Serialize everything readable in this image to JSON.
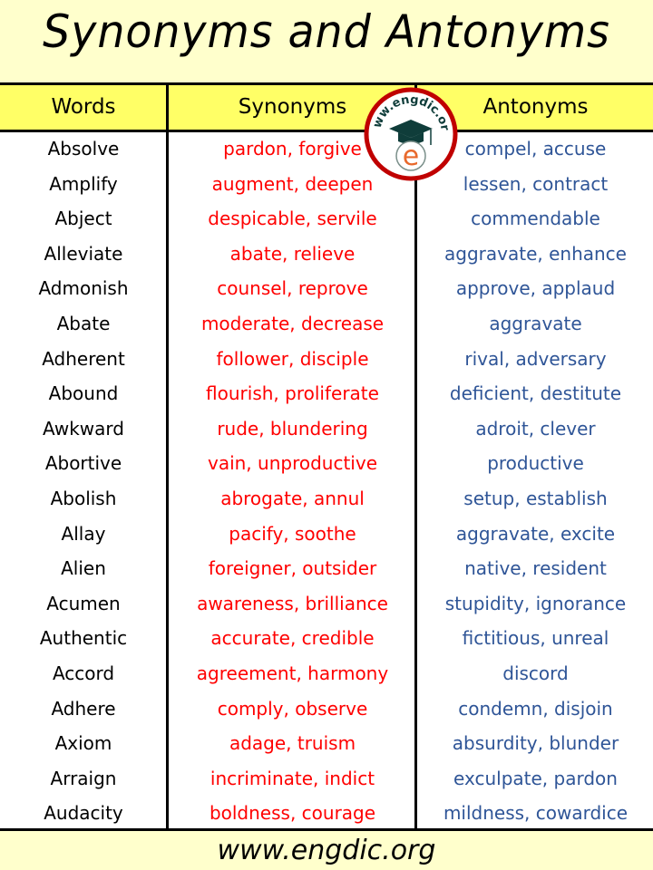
{
  "title": "Synonyms and Antonyms",
  "header": {
    "words": "Words",
    "synonyms": "Synonyms",
    "antonyms": "Antonyms"
  },
  "logo": {
    "text": "www.engdic.org",
    "letter": "e",
    "ring_color": "#c00000",
    "cap_color": "#0f3d3a",
    "letter_color": "#e8692c"
  },
  "colors": {
    "title_bg": "#ffffcc",
    "header_bg": "#ffff66",
    "synonym_text": "#ff0000",
    "antonym_text": "#2f5597"
  },
  "rows": [
    {
      "word": "Absolve",
      "synonyms": "pardon, forgive",
      "antonyms": "compel, accuse"
    },
    {
      "word": "Amplify",
      "synonyms": "augment, deepen",
      "antonyms": "lessen, contract"
    },
    {
      "word": "Abject",
      "synonyms": "despicable, servile",
      "antonyms": "commendable"
    },
    {
      "word": "Alleviate",
      "synonyms": "abate, relieve",
      "antonyms": "aggravate, enhance"
    },
    {
      "word": "Admonish",
      "synonyms": "counsel, reprove",
      "antonyms": "approve, applaud"
    },
    {
      "word": "Abate",
      "synonyms": "moderate, decrease",
      "antonyms": "aggravate"
    },
    {
      "word": "Adherent",
      "synonyms": "follower, disciple",
      "antonyms": "rival, adversary"
    },
    {
      "word": "Abound",
      "synonyms": "flourish, proliferate",
      "antonyms": "deficient, destitute"
    },
    {
      "word": "Awkward",
      "synonyms": "rude, blundering",
      "antonyms": "adroit, clever"
    },
    {
      "word": "Abortive",
      "synonyms": "vain, unproductive",
      "antonyms": "productive"
    },
    {
      "word": "Abolish",
      "synonyms": "abrogate, annul",
      "antonyms": "setup, establish"
    },
    {
      "word": "Allay",
      "synonyms": "pacify, soothe",
      "antonyms": "aggravate, excite"
    },
    {
      "word": "Alien",
      "synonyms": "foreigner, outsider",
      "antonyms": "native, resident"
    },
    {
      "word": "Acumen",
      "synonyms": "awareness, brilliance",
      "antonyms": "stupidity, ignorance"
    },
    {
      "word": "Authentic",
      "synonyms": "accurate, credible",
      "antonyms": "fictitious, unreal"
    },
    {
      "word": "Accord",
      "synonyms": "agreement, harmony",
      "antonyms": "discord"
    },
    {
      "word": "Adhere",
      "synonyms": "comply, observe",
      "antonyms": "condemn, disjoin"
    },
    {
      "word": "Axiom",
      "synonyms": "adage, truism",
      "antonyms": "absurdity, blunder"
    },
    {
      "word": "Arraign",
      "synonyms": "incriminate, indict",
      "antonyms": "exculpate, pardon"
    },
    {
      "word": "Audacity",
      "synonyms": "boldness, courage",
      "antonyms": "mildness, cowardice"
    }
  ],
  "footer": "www.engdic.org"
}
